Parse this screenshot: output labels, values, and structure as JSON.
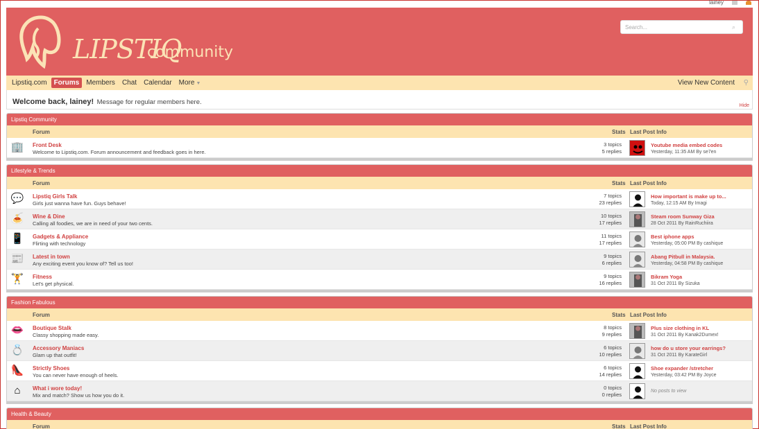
{
  "userbar": {
    "username": "lainey"
  },
  "brand": {
    "logo_text": "LIPSTIQ",
    "logo_sub": "community"
  },
  "search": {
    "placeholder": "Search..."
  },
  "nav": {
    "items": [
      "Lipstiq.com",
      "Forums",
      "Members",
      "Chat",
      "Calendar",
      "More"
    ],
    "active": "Forums",
    "view_new": "View New Content"
  },
  "welcome": {
    "hello": "Welcome back, lainey!",
    "message": "Message for regular members here.",
    "hide": "Hide"
  },
  "columns": {
    "forum": "Forum",
    "stats": "Stats",
    "last_post": "Last Post Info"
  },
  "colors": {
    "accent": "#e06060",
    "nav_bg": "#fde4b0",
    "link": "#d04040"
  },
  "categories": [
    {
      "name": "Lipstiq Community",
      "forums": [
        {
          "icon": "front-desk-icon",
          "glyph": "🏢",
          "title": "Front Desk",
          "desc": "Welcome to Lipstiq.com. Forum announcement and feedback goes in here.",
          "topics": "3 topics",
          "replies": "5 replies",
          "last_title": "Youtube media embed codes",
          "last_meta": "Yesterday, 11:35 AM By se7en",
          "avatar": "red"
        }
      ]
    },
    {
      "name": "Lifestyle & Trends",
      "forums": [
        {
          "icon": "chat-bubbles-icon",
          "glyph": "💬",
          "title": "Lipstiq Girls Talk",
          "desc": "Girls just wanna have fun. Guys behave!",
          "topics": "7 topics",
          "replies": "23 replies",
          "last_title": "How important is make up to...",
          "last_meta": "Today, 12:15 AM By Imagi",
          "avatar": "silhouette"
        },
        {
          "icon": "food-icon",
          "glyph": "🍝",
          "title": "Wine & Dine",
          "desc": "Calling all foodies, we are in need of your two cents.",
          "topics": "10 topics",
          "replies": "17 replies",
          "last_title": "Steam room Sunway Giza",
          "last_meta": "28 Oct 2011 By RainRuchiira",
          "avatar": "photo"
        },
        {
          "icon": "phone-icon",
          "glyph": "📱",
          "title": "Gadgets & Appliance",
          "desc": "Flirting with technology",
          "topics": "11 topics",
          "replies": "17 replies",
          "last_title": "Best iphone apps",
          "last_meta": "Yesterday, 05:00 PM By cashique",
          "avatar": "gray"
        },
        {
          "icon": "newspaper-icon",
          "glyph": "📰",
          "title": "Latest in town",
          "desc": "Any exciting event you know of? Tell us too!",
          "topics": "9 topics",
          "replies": "6 replies",
          "last_title": "Abang Pitbull in Malaysia.",
          "last_meta": "Yesterday, 04:58 PM By cashique",
          "avatar": "gray"
        },
        {
          "icon": "dumbbell-icon",
          "glyph": "🏋",
          "title": "Fitness",
          "desc": "Let's get physical.",
          "topics": "9 topics",
          "replies": "16 replies",
          "last_title": "Bikram Yoga",
          "last_meta": "31 Oct 2011 By Sizuka",
          "avatar": "photo"
        }
      ]
    },
    {
      "name": "Fashion Fabulous",
      "forums": [
        {
          "icon": "lips-icon",
          "glyph": "👄",
          "title": "Boutique Stalk",
          "desc": "Classy shopping made easy.",
          "topics": "8 topics",
          "replies": "9 replies",
          "last_title": "Plus size clothing in KL",
          "last_meta": "31 Oct 2011 By Kanak2Dumex!",
          "avatar": "photo"
        },
        {
          "icon": "ring-icon",
          "glyph": "💍",
          "title": "Accessory Maniacs",
          "desc": "Glam up that outfit!",
          "topics": "6 topics",
          "replies": "10 replies",
          "last_title": "how do u store your earrings?",
          "last_meta": "31 Oct 2011 By KarateGirl",
          "avatar": "gray"
        },
        {
          "icon": "shoe-icon",
          "glyph": "👠",
          "title": "Strictly Shoes",
          "desc": "You can never have enough of heels.",
          "topics": "6 topics",
          "replies": "14 replies",
          "last_title": "Shoe expander /stretcher",
          "last_meta": "Yesterday, 03:42 PM By Joyce",
          "avatar": "silhouette"
        },
        {
          "icon": "hanger-icon",
          "glyph": "⌂",
          "title": "What i wore today!",
          "desc": "Mix and match? Show us how you do it.",
          "topics": "0 topics",
          "replies": "0 replies",
          "last_title": "",
          "last_meta": "",
          "no_posts": "No posts to view",
          "avatar": "silhouette"
        }
      ]
    },
    {
      "name": "Health & Beauty",
      "forums": []
    }
  ]
}
